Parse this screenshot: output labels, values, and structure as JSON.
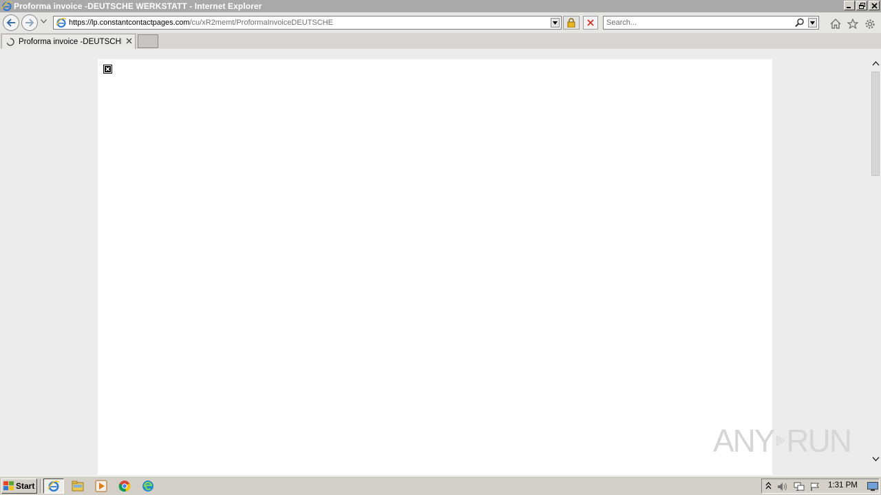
{
  "window": {
    "title": "Proforma invoice -DEUTSCHE WERKSTATT - Internet Explorer"
  },
  "address_bar": {
    "url_host": "https://lp.constantcontactpages.com",
    "url_path": "/cu/xR2memt/ProformaInvoiceDEUTSCHE"
  },
  "search": {
    "placeholder": "Search..."
  },
  "tabs": [
    {
      "label": "Proforma invoice -DEUTSCHE...",
      "loading": true
    }
  ],
  "content": {
    "broken_image_icon": "broken-image-icon"
  },
  "watermark": {
    "text_left": "ANY",
    "text_right": "RUN"
  },
  "taskbar": {
    "start_label": "Start",
    "apps": [
      "internet-explorer-icon",
      "file-explorer-icon",
      "media-player-icon",
      "chrome-icon",
      "edge-icon"
    ],
    "clock": "1:31 PM"
  }
}
